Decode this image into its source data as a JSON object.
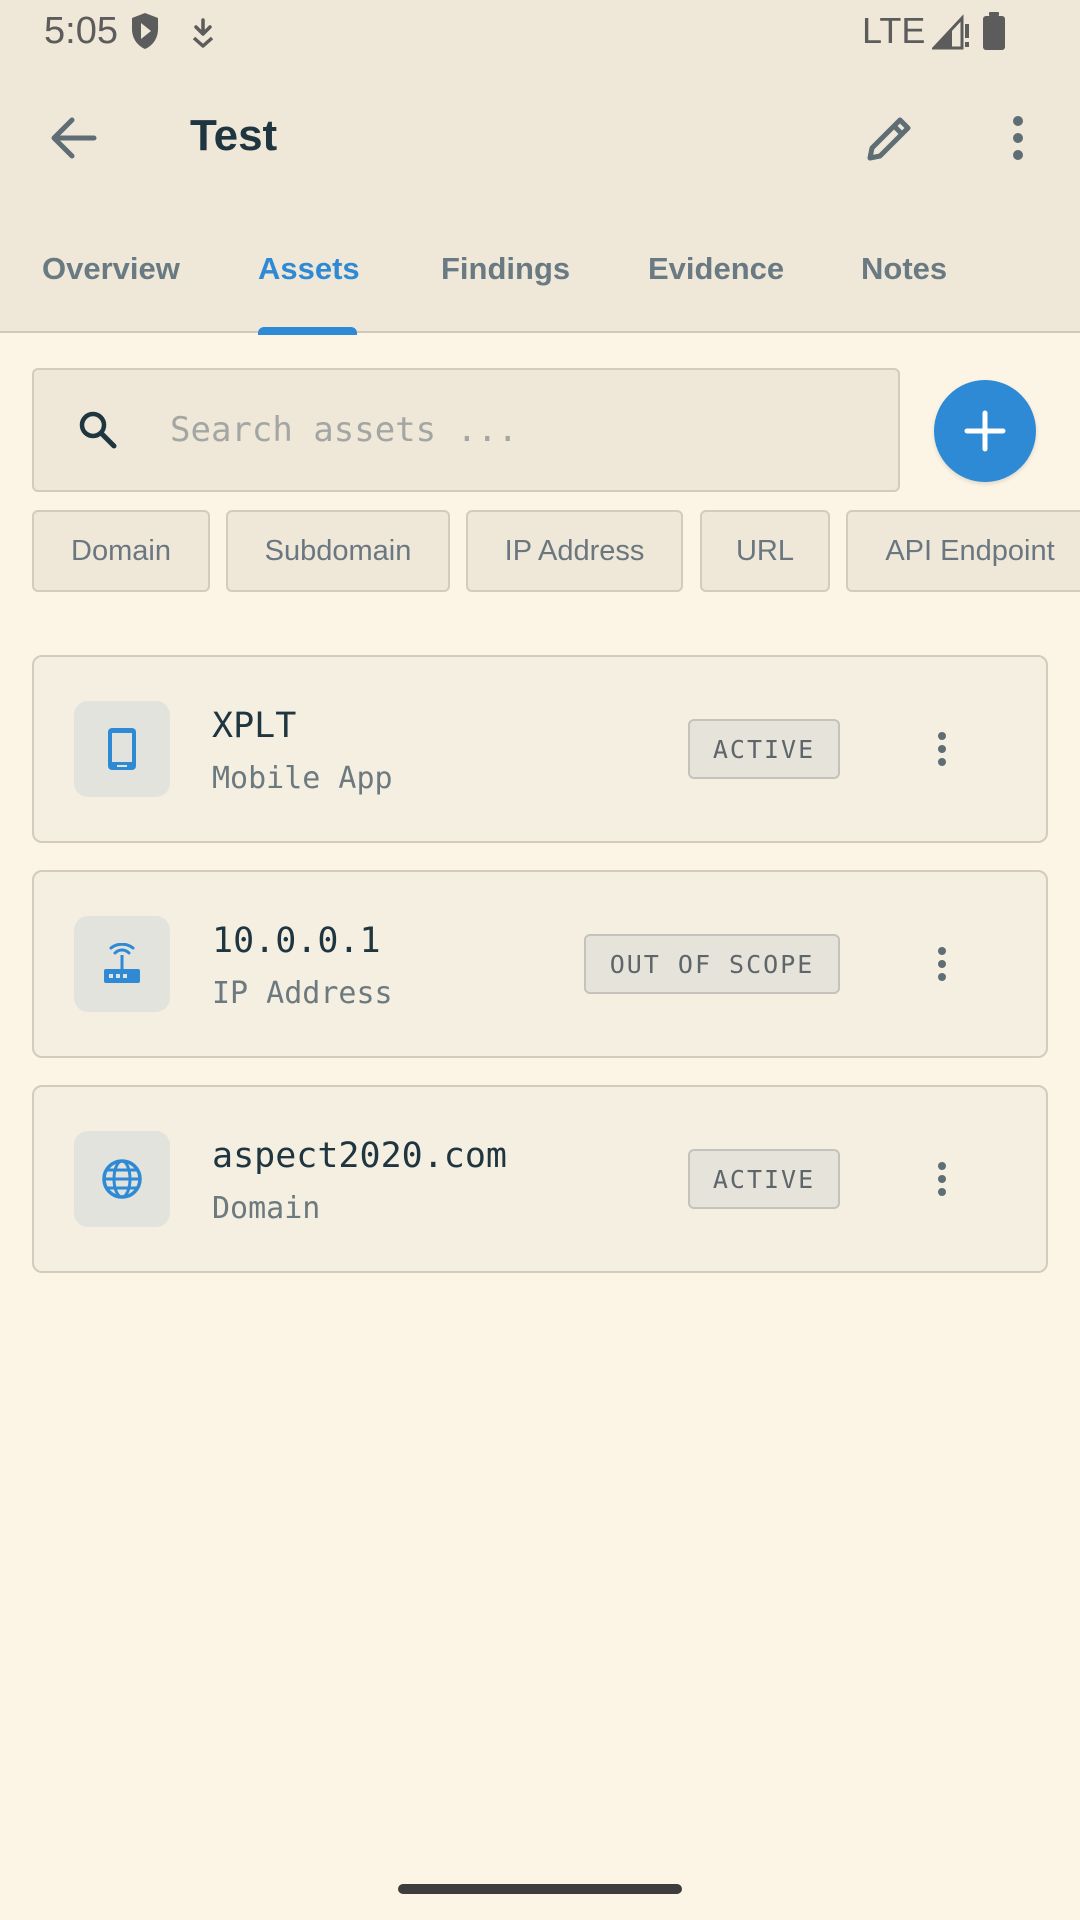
{
  "status_bar": {
    "time": "5:05",
    "network": "LTE",
    "icons": [
      "shield-icon",
      "download-icon",
      "signal-icon",
      "battery-icon"
    ]
  },
  "app_bar": {
    "title": "Test",
    "icons": [
      "back-arrow-icon",
      "pencil-icon",
      "more-vert-icon"
    ]
  },
  "tabs": [
    {
      "label": "Overview"
    },
    {
      "label": "Assets",
      "active": true
    },
    {
      "label": "Findings"
    },
    {
      "label": "Evidence"
    },
    {
      "label": "Notes"
    }
  ],
  "search": {
    "placeholder": "Search assets ...",
    "value": ""
  },
  "filter_chips": [
    {
      "label": "Domain"
    },
    {
      "label": "Subdomain"
    },
    {
      "label": "IP Address"
    },
    {
      "label": "URL"
    },
    {
      "label": "API Endpoint"
    }
  ],
  "assets": [
    {
      "name": "XPLT",
      "type": "Mobile App",
      "status": "ACTIVE",
      "icon": "smartphone-icon"
    },
    {
      "name": "10.0.0.1",
      "type": "IP Address",
      "status": "OUT OF SCOPE",
      "icon": "router-icon"
    },
    {
      "name": "aspect2020.com",
      "type": "Domain",
      "status": "ACTIVE",
      "icon": "globe-icon"
    }
  ],
  "colors": {
    "accent": "#2f8ad5",
    "background": "#fcf5e5",
    "top_bar": "#efe7d7",
    "title_text": "#1f3540"
  }
}
